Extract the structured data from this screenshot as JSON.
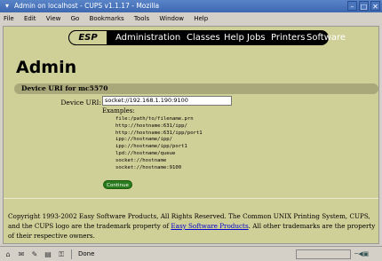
{
  "window": {
    "title": "Admin on localhost - CUPS v1.1.17 - Mozilla"
  },
  "menu": [
    "File",
    "Edit",
    "View",
    "Go",
    "Bookmarks",
    "Tools",
    "Window",
    "Help"
  ],
  "nav": {
    "logo": "ESP",
    "items": [
      "Administration",
      "Classes",
      "Help",
      "Jobs",
      "Printers",
      "Software"
    ]
  },
  "page": {
    "heading": "Admin",
    "section_title": "Device URI for mc5570",
    "field_label": "Device URI:",
    "field_value": "socket://192.168.1.190:9100",
    "examples_label": "Examples:",
    "examples": [
      "file:/path/to/filename.prn",
      "http://hostname:631/ipp/",
      "http://hostname:631/ipp/port1",
      "ipp://hostname/ipp/",
      "ipp://hostname/ipp/port1",
      "lpd://hostname/queue",
      "socket://hostname",
      "socket://hostname:9100"
    ],
    "continue_label": "Continue"
  },
  "footer": {
    "text_before": "Copyright 1993-2002 Easy Software Products, All Rights Reserved. The Common UNIX Printing System, CUPS, and the CUPS logo are the trademark property of ",
    "link": "Easy Software Products",
    "text_after": ". All other trademarks are the property of their respective owners."
  },
  "status": {
    "text": "Done"
  },
  "icons": [
    "mozilla-icon",
    "minimize-icon",
    "maximize-icon",
    "close-icon",
    "navigator-icon",
    "mail-icon",
    "composer-icon",
    "addressbook-icon",
    "security-icon"
  ]
}
